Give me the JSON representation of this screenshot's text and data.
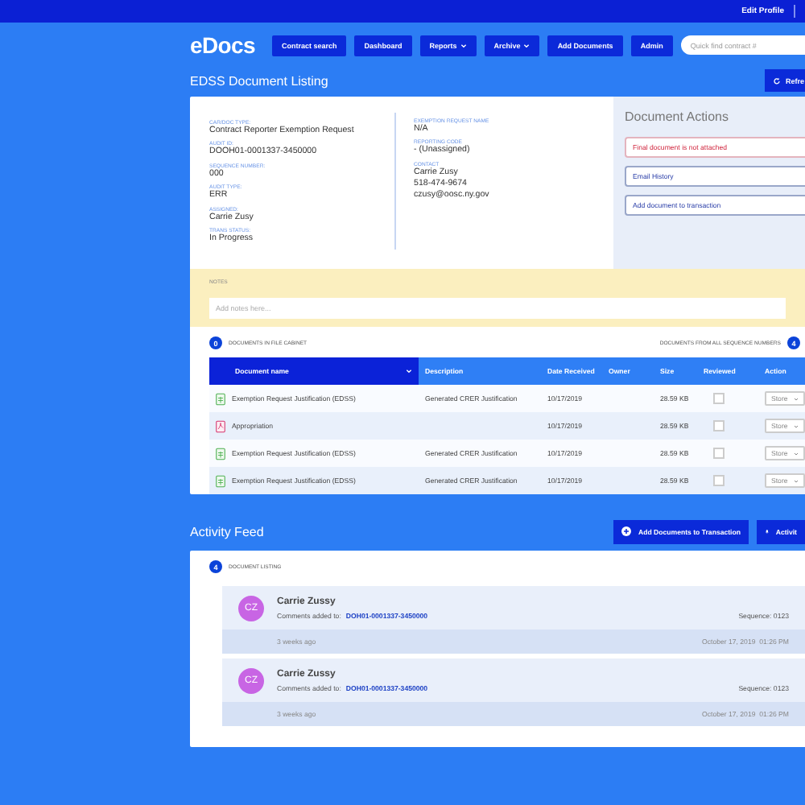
{
  "top_bar": {
    "edit_profile": "Edit Profile"
  },
  "nav": {
    "logo": "eDocs",
    "buttons": [
      {
        "label": "Contract search",
        "has_menu": false
      },
      {
        "label": "Dashboard",
        "has_menu": false
      },
      {
        "label": "Reports",
        "has_menu": true
      },
      {
        "label": "Archive",
        "has_menu": true
      },
      {
        "label": "Add Documents",
        "has_menu": false
      },
      {
        "label": "Admin",
        "has_menu": false
      }
    ],
    "search": {
      "placeholder": "Quick find contract #"
    }
  },
  "page_title": "EDSS Document Listing",
  "refresh_button": "Refre",
  "details": {
    "left": [
      {
        "label": "CAR/DOC TYPE:",
        "values": [
          "Contract Reporter Exemption Request"
        ]
      },
      {
        "label": "AUDIT ID:",
        "values": [
          "DOOH01-0001337-3450000"
        ]
      },
      {
        "label": "SEQUENCE NUMBER:",
        "values": [
          "000"
        ]
      },
      {
        "label": "AUDIT TYPE:",
        "values": [
          "ERR"
        ]
      },
      {
        "label": "ASSIGNED:",
        "values": [
          "Carrie Zusy"
        ]
      },
      {
        "label": "TRANS STATUS:",
        "values": [
          "In Progress"
        ]
      }
    ],
    "right": [
      {
        "label": "EXEMPTION REQUEST NAME",
        "values": [
          "N/A"
        ]
      },
      {
        "label": "REPORTING CODE",
        "values": [
          "- (Unassigned)"
        ]
      },
      {
        "label": "CONTACT",
        "values": [
          "Carrie Zusy",
          "518-474-9674",
          "czusy@oosc.ny.gov"
        ]
      }
    ]
  },
  "document_actions": {
    "title": "Document Actions",
    "items": [
      {
        "label": "Final document is not attached",
        "kind": "warning"
      },
      {
        "label": "Email History",
        "kind": "action"
      },
      {
        "label": "Add document to transaction",
        "kind": "action"
      }
    ]
  },
  "notes": {
    "label": "NOTES",
    "placeholder": "Add notes here..."
  },
  "documents": {
    "cabinet_count": "0",
    "cabinet_label": "DOCUMENTS IN FILE CABINET",
    "all_label": "DOCUMENTS FROM ALL SEQUENCE NUMBERS",
    "all_count": "4"
  },
  "table": {
    "columns": [
      {
        "label": "Document name",
        "sorted": true
      },
      {
        "label": "Description",
        "sorted": false
      },
      {
        "label": "Date Received",
        "sorted": false
      },
      {
        "label": "Owner",
        "sorted": false
      },
      {
        "label": "Size",
        "sorted": false
      },
      {
        "label": "Reviewed",
        "sorted": false
      },
      {
        "label": "Action",
        "sorted": false
      }
    ],
    "rows": [
      {
        "kind": "sheet",
        "name": "Exemption Request Justification (EDSS)",
        "description": "Generated CRER Justification",
        "date": "10/17/2019",
        "size": "28.59 KB",
        "reviewed": false,
        "action": "Store"
      },
      {
        "kind": "pdf",
        "name": "Appropriation",
        "date": "10/17/2019",
        "size": "28.59 KB",
        "reviewed": false,
        "action": "Store"
      },
      {
        "kind": "sheet",
        "name": "Exemption Request Justification (EDSS)",
        "description": "Generated CRER Justification",
        "date": "10/17/2019",
        "size": "28.59 KB",
        "reviewed": false,
        "action": "Store"
      },
      {
        "kind": "sheet",
        "name": "Exemption Request Justification (EDSS)",
        "description": "Generated CRER Justification",
        "date": "10/17/2019",
        "size": "28.59 KB",
        "reviewed": false,
        "action": "Store"
      }
    ]
  },
  "activity": {
    "title": "Activity Feed",
    "buttons": [
      {
        "label": "Add Documents to Transaction",
        "kind": "add"
      },
      {
        "label": "Activit",
        "kind": "notify"
      }
    ],
    "count": "4",
    "count_label": "DOCUMENT LISTING",
    "items": [
      {
        "avatar": "CZ",
        "name": "Carrie Zussy",
        "comment_label": "Comments added to:",
        "link": "DOH01-0001337-3450000",
        "sequence": "Sequence: 0123",
        "ago": "3 weeks ago",
        "date": "October 17, 2019  01:26 PM"
      },
      {
        "avatar": "CZ",
        "name": "Carrie Zussy",
        "comment_label": "Comments added to:",
        "link": "DOH01-0001337-3450000",
        "sequence": "Sequence: 0123",
        "ago": "3 weeks ago",
        "date": "October 17, 2019  01:26 PM"
      }
    ]
  }
}
